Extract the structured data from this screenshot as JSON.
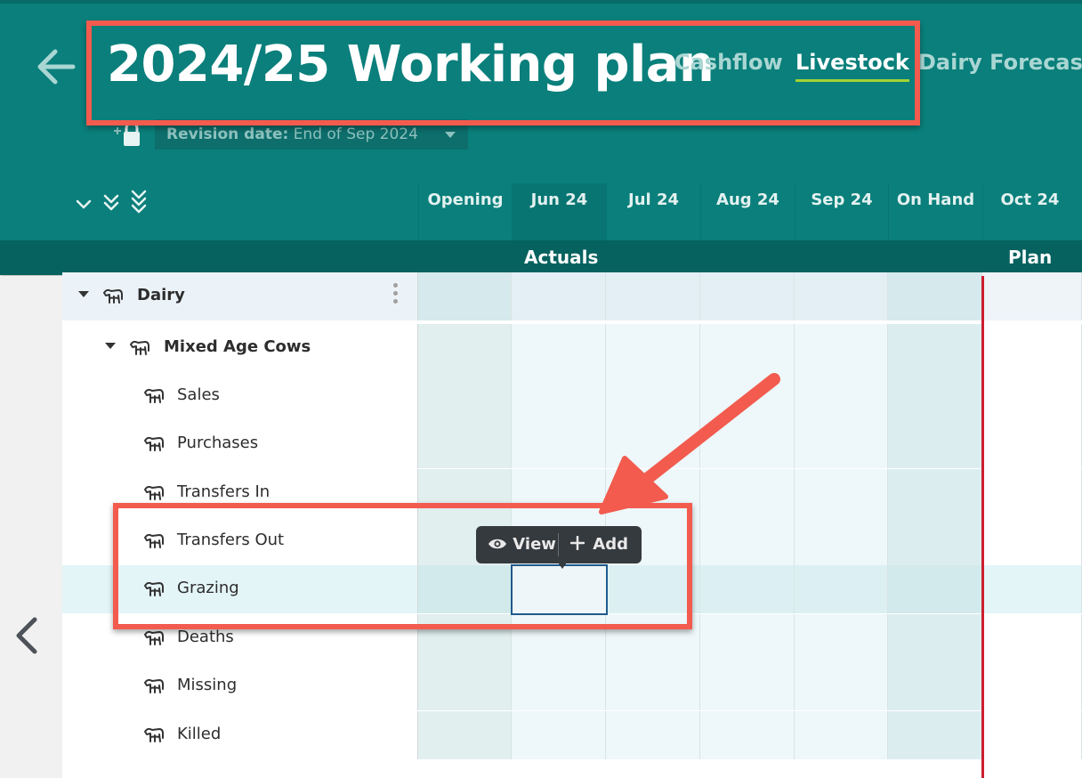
{
  "header": {
    "title": "2024/25 Working plan",
    "tabs": [
      {
        "label": "Cashflow",
        "active": false
      },
      {
        "label": "Livestock",
        "active": true
      },
      {
        "label": "Dairy Forecaster",
        "active": false
      }
    ],
    "revision": {
      "label": "Revision date:",
      "value": "End of Sep 2024"
    }
  },
  "columns": [
    "Opening",
    "Jun 24",
    "Jul 24",
    "Aug 24",
    "Sep 24",
    "On Hand",
    "Oct 24"
  ],
  "sections": {
    "actuals": "Actuals",
    "plan": "Plan"
  },
  "rows": [
    {
      "label": "Dairy",
      "level": 0,
      "expandable": true
    },
    {
      "label": "Mixed Age Cows",
      "level": 1,
      "expandable": true
    },
    {
      "label": "Sales",
      "level": 2
    },
    {
      "label": "Purchases",
      "level": 2
    },
    {
      "label": "Transfers In",
      "level": 2
    },
    {
      "label": "Transfers Out",
      "level": 2
    },
    {
      "label": "Grazing",
      "level": 2,
      "selected": true
    },
    {
      "label": "Deaths",
      "level": 2
    },
    {
      "label": "Missing",
      "level": 2
    },
    {
      "label": "Killed",
      "level": 2
    }
  ],
  "popup": {
    "view": "View",
    "add": "Add"
  },
  "colors": {
    "header": "#0a7f7b",
    "section_bar": "#05625f",
    "active_tab_underline": "#a4d233",
    "annotation": "#f25b4e",
    "plan_divider": "#cc1f2d"
  }
}
